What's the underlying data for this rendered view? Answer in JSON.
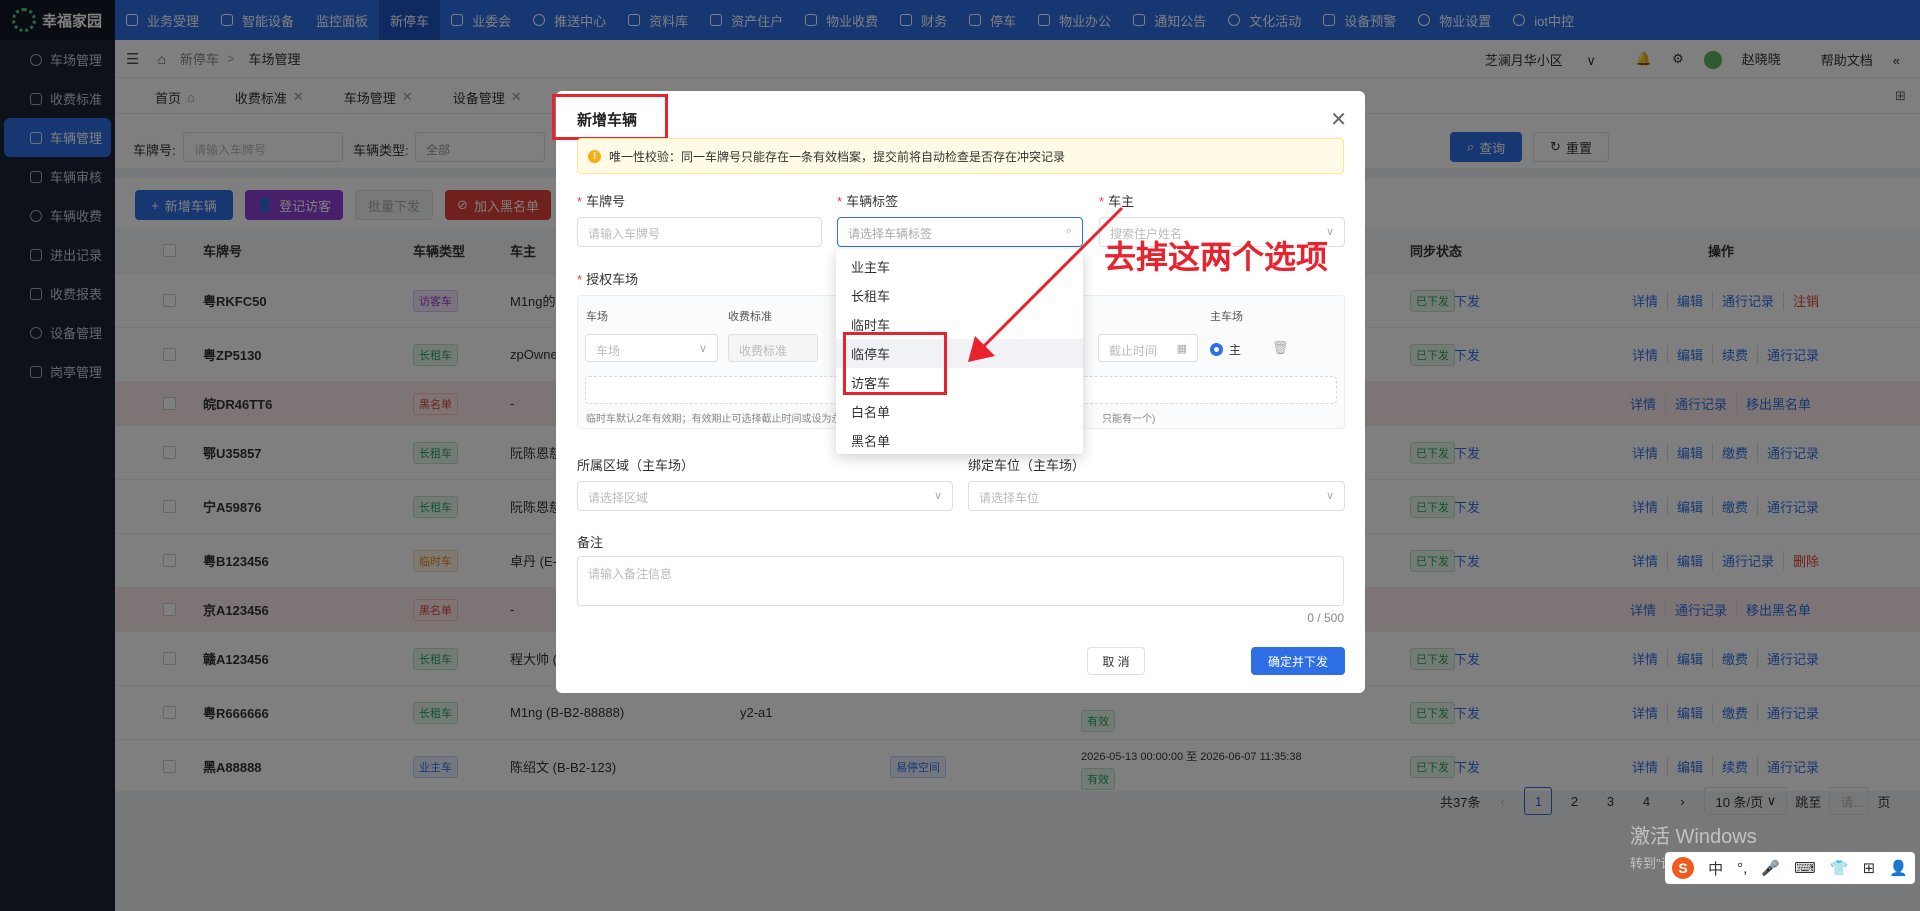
{
  "brand": {
    "name": "幸福家园"
  },
  "sidebar": {
    "items": [
      {
        "label": "车场管理",
        "icon": "gear-icon"
      },
      {
        "label": "收费标准",
        "icon": "b4-icon"
      },
      {
        "label": "车辆管理",
        "icon": "car-icon",
        "active": true
      },
      {
        "label": "车辆审核",
        "icon": "audit-icon"
      },
      {
        "label": "车辆收费",
        "icon": "fee-icon"
      },
      {
        "label": "进出记录",
        "icon": "record-icon"
      },
      {
        "label": "收费报表",
        "icon": "report-icon"
      },
      {
        "label": "设备管理",
        "icon": "device-icon"
      },
      {
        "label": "岗亭管理",
        "icon": "booth-icon"
      }
    ]
  },
  "topnav": {
    "items": [
      "业务受理",
      "智能设备",
      "监控面板",
      "新停车",
      "业委会",
      "推送中心",
      "资料库",
      "资产住户",
      "物业收费",
      "财务",
      "停车",
      "物业办公",
      "通知公告",
      "文化活动",
      "设备预警",
      "物业设置",
      "iot中控"
    ],
    "active": "新停车"
  },
  "breadcrumb": {
    "items": [
      "新停车",
      "车场管理"
    ]
  },
  "header_right": {
    "community": "芝澜月华小区",
    "user": "赵晓晓",
    "help": "帮助文档"
  },
  "tabs": [
    "首页",
    "收费标准",
    "车场管理",
    "设备管理"
  ],
  "filter": {
    "plate_label": "车牌号:",
    "plate_placeholder": "请输入车牌号",
    "type_label": "车辆类型:",
    "type_value": "全部",
    "search": "查询",
    "reset": "重置"
  },
  "toolbar": {
    "add": "新增车辆",
    "visitor": "登记访客",
    "batch": "批量下发",
    "blacklist": "加入黑名单"
  },
  "table": {
    "headers": {
      "plate": "车牌号",
      "type": "车辆类型",
      "owner": "车主",
      "sync": "同步状态",
      "ops": "操作"
    },
    "rows": [
      {
        "plate": "粤RKFC50",
        "type": "访客车",
        "type_class": "visit",
        "owner": "M1ng的",
        "sync": "已下发",
        "send": "下发",
        "ops": [
          "详情",
          "编辑",
          "通行记录",
          "注销"
        ],
        "danger": "注销"
      },
      {
        "plate": "粤ZP5130",
        "type": "长租车",
        "type_class": "long",
        "owner": "zpOwne",
        "sync": "已下发",
        "send": "下发",
        "ops": [
          "详情",
          "编辑",
          "续费",
          "通行记录"
        ]
      },
      {
        "plate": "皖DR46TT6",
        "type": "黑名单",
        "type_class": "black",
        "owner": "-",
        "sync": "",
        "send": "",
        "ops": [
          "详情",
          "通行记录",
          "移出黑名单"
        ],
        "black": true
      },
      {
        "plate": "鄂U35857",
        "type": "长租车",
        "type_class": "long",
        "owner": "阮陈恩慈",
        "sync": "已下发",
        "send": "下发",
        "ops": [
          "详情",
          "编辑",
          "缴费",
          "通行记录"
        ]
      },
      {
        "plate": "宁A59876",
        "type": "长租车",
        "type_class": "long",
        "owner": "阮陈恩慈",
        "sync": "已下发",
        "send": "下发",
        "ops": [
          "详情",
          "编辑",
          "缴费",
          "通行记录"
        ]
      },
      {
        "plate": "粤B123456",
        "type": "临时车",
        "type_class": "temp",
        "owner": "卓丹 (E-",
        "sync": "已下发",
        "send": "下发",
        "ops": [
          "详情",
          "编辑",
          "通行记录",
          "删除"
        ],
        "danger": "删除"
      },
      {
        "plate": "京A123456",
        "type": "黑名单",
        "type_class": "black",
        "owner": "-",
        "sync": "",
        "send": "",
        "ops": [
          "详情",
          "通行记录",
          "移出黑名单"
        ],
        "black": true
      },
      {
        "plate": "赣A123456",
        "type": "长租车",
        "type_class": "long",
        "owner": "程大帅 (",
        "sync": "已下发",
        "send": "下发",
        "ops": [
          "详情",
          "编辑",
          "缴费",
          "通行记录"
        ]
      },
      {
        "plate": "粤R666666",
        "type": "长租车",
        "type_class": "long",
        "owner": "M1ng (B-B2-88888)",
        "extra": "y2-a1",
        "sync": "已下发",
        "send": "下发",
        "ops": [
          "详情",
          "编辑",
          "缴费",
          "通行记录"
        ],
        "valid": "有效"
      },
      {
        "plate": "黑A88888",
        "type": "业主车",
        "type_class": "owner",
        "owner": "陈绍文 (B-B2-123)",
        "area": "易停空间",
        "period": "2026-05-13 00:00:00 至 2026-06-07 11:35:38",
        "valid": "有效",
        "sync": "已下发",
        "send": "下发",
        "ops": [
          "详情",
          "编辑",
          "续费",
          "通行记录"
        ]
      }
    ]
  },
  "pager": {
    "total": "共37条",
    "pages": [
      "1",
      "2",
      "3",
      "4"
    ],
    "current": "1",
    "size": "10 条/页",
    "jump": "跳至",
    "jump_placeholder": "请...",
    "page_suffix": "页"
  },
  "modal": {
    "title": "新增车辆",
    "notice": "唯一性校验：同一车牌号只能存在一条有效档案，提交前将自动检查是否存在冲突记录",
    "plate_label": "车牌号",
    "plate_placeholder": "请输入车牌号",
    "tag_label": "车辆标签",
    "tag_placeholder": "请选择车辆标签",
    "owner_label": "车主",
    "owner_placeholder": "搜索住户姓名",
    "auth_label": "授权车场",
    "auth_cols": {
      "lot": "车场",
      "fee": "收费标准",
      "main": "主车场"
    },
    "lot_placeholder": "车场",
    "fee_placeholder": "收费标准",
    "end_placeholder": "截止时间",
    "main_radio": "主",
    "auth_hint": "临时车默认2年有效期；有效期止可选择截止时间或设为永",
    "auth_hint_tail": "只能有一个)",
    "area_label": "所属区域（主车场）",
    "area_placeholder": "请选择区域",
    "space_label": "绑定车位（主车场）",
    "space_placeholder": "请选择车位",
    "remark_label": "备注",
    "remark_placeholder": "请输入备注信息",
    "counter": "0 / 500",
    "cancel": "取 消",
    "confirm": "确定并下发"
  },
  "dropdown": {
    "options": [
      "业主车",
      "长租车",
      "临时车",
      "临停车",
      "访客车",
      "白名单",
      "黑名单"
    ],
    "highlighted": "临停车"
  },
  "annotation": {
    "text": "去掉这两个选项",
    "color": "#e8232d"
  },
  "system": {
    "activate_title": "激活 Windows",
    "activate_sub": "转到\"设置\"以激活 Windows。",
    "ime": [
      "中",
      "°,",
      "🎤",
      "⌨",
      "👕",
      "⊞",
      "👤"
    ]
  },
  "colors": {
    "primary": "#2f6fe6",
    "danger": "#e0413b",
    "sidebar": "#1a2434",
    "annotation": "#e8232d"
  }
}
